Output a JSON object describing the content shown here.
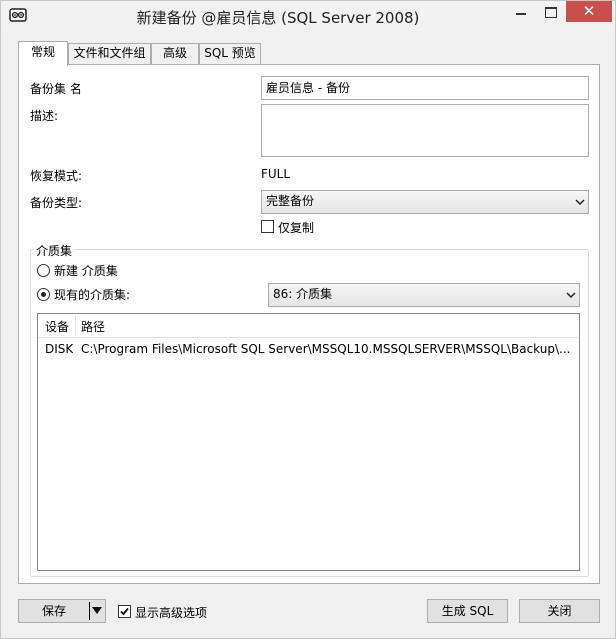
{
  "window": {
    "title": "新建备份 @雇员信息 (SQL Server 2008)",
    "close_glyph": "✕"
  },
  "tabs": [
    {
      "label": "常规",
      "active": true
    },
    {
      "label": "文件和文件组",
      "active": false
    },
    {
      "label": "高级",
      "active": false
    },
    {
      "label": "SQL 预览",
      "active": false
    }
  ],
  "general": {
    "backup_set_name_label": "备份集 名",
    "backup_set_name_value": "雇员信息 - 备份",
    "description_label": "描述:",
    "description_value": "",
    "recovery_model_label": "恢复模式:",
    "recovery_model_value": "FULL",
    "backup_type_label": "备份类型:",
    "backup_type_value": "完整备份",
    "copy_only_label": "仅复制",
    "copy_only_checked": false
  },
  "media_set": {
    "group_title": "介质集",
    "new_media_label": "新建 介质集",
    "new_media_selected": false,
    "existing_media_label": "现有的介质集:",
    "existing_media_selected": true,
    "existing_media_value": "86: 介质集",
    "list": {
      "columns": [
        "设备",
        "路径"
      ],
      "rows": [
        {
          "device": "DISK",
          "path": "C:\\Program Files\\Microsoft SQL Server\\MSSQL10.MSSQLSERVER\\MSSQL\\Backup\\..."
        }
      ]
    }
  },
  "footer": {
    "save_label": "保存",
    "show_advanced_label": "显示高级选项",
    "show_advanced_checked": true,
    "generate_sql_label": "生成 SQL",
    "close_label": "关闭"
  },
  "colors": {
    "close_button": "#c7504d",
    "window_bg": "#f0f0f0",
    "panel_bg": "#ffffff"
  }
}
